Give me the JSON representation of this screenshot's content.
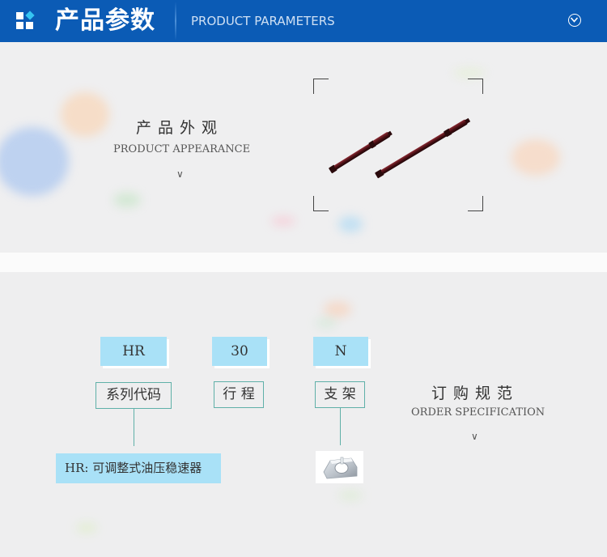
{
  "header": {
    "title": "产品参数",
    "subtitle": "PRODUCT PARAMETERS",
    "expand_icon": "chevron-down-circle-icon",
    "logo_icon": "squares-diamond-icon"
  },
  "appearance": {
    "title_cn": "产品外观",
    "title_en": "PRODUCT APPEARANCE",
    "arrow": "∨",
    "image": "two-dark-red-stabilizer-rods"
  },
  "order_spec": {
    "title_cn": "订购规范",
    "title_en": "ORDER SPECIFICATION",
    "arrow": "∨",
    "fields": [
      {
        "code": "HR",
        "label": "系列代码"
      },
      {
        "code": "30",
        "label": "行 程"
      },
      {
        "code": "N",
        "label": "支 架"
      }
    ],
    "series_note": "HR: 可调整式油压稳速器",
    "bracket_image": "aluminum-mounting-bracket"
  },
  "colors": {
    "header_bg": "#0b5bb5",
    "code_box": "#a9e1f7",
    "label_border": "#5fb0a8",
    "rod": "#4a0f14"
  }
}
